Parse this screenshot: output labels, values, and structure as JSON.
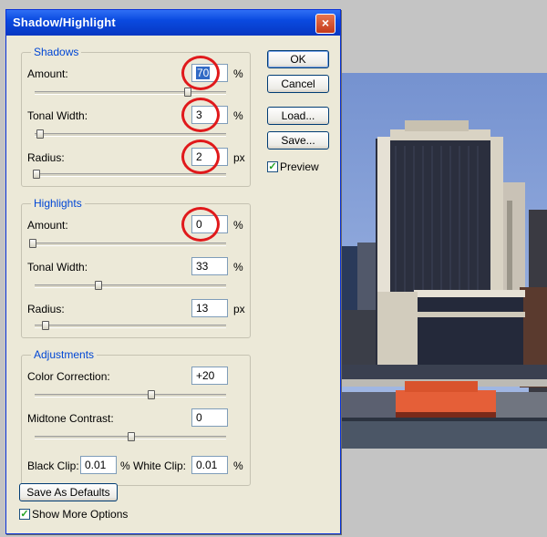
{
  "window": {
    "title": "Shadow/Highlight",
    "close_glyph": "×"
  },
  "shadows": {
    "title": "Shadows",
    "amount": {
      "label": "Amount:",
      "value": "70",
      "unit": "%",
      "slider": 0.7
    },
    "tonal_width": {
      "label": "Tonal Width:",
      "value": "3",
      "unit": "%",
      "slider": 0.03
    },
    "radius": {
      "label": "Radius:",
      "value": "2",
      "unit": "px",
      "slider": 0.01
    }
  },
  "highlights": {
    "title": "Highlights",
    "amount": {
      "label": "Amount:",
      "value": "0",
      "unit": "%",
      "slider": 0.0
    },
    "tonal_width": {
      "label": "Tonal Width:",
      "value": "33",
      "unit": "%",
      "slider": 0.33
    },
    "radius": {
      "label": "Radius:",
      "value": "13",
      "unit": "px",
      "slider": 0.05
    }
  },
  "adjustments": {
    "title": "Adjustments",
    "color_correction": {
      "label": "Color Correction:",
      "value": "+20",
      "slider": 0.6
    },
    "midtone_contrast": {
      "label": "Midtone Contrast:",
      "value": "0",
      "slider": 0.5
    },
    "black_clip": {
      "label": "Black Clip:",
      "value": "0.01",
      "unit": "%"
    },
    "white_clip": {
      "label": "White Clip:",
      "value": "0.01",
      "unit": "%"
    }
  },
  "buttons": {
    "ok": "OK",
    "cancel": "Cancel",
    "load": "Load...",
    "save": "Save...",
    "save_defaults": "Save As Defaults"
  },
  "preview": {
    "label": "Preview",
    "checked": true
  },
  "show_more": {
    "label": "Show More Options",
    "checked": true
  },
  "colors": {
    "accent": "#0046d5",
    "highlight_circle": "#e0191b",
    "titlebar": "#0a4ae0"
  }
}
